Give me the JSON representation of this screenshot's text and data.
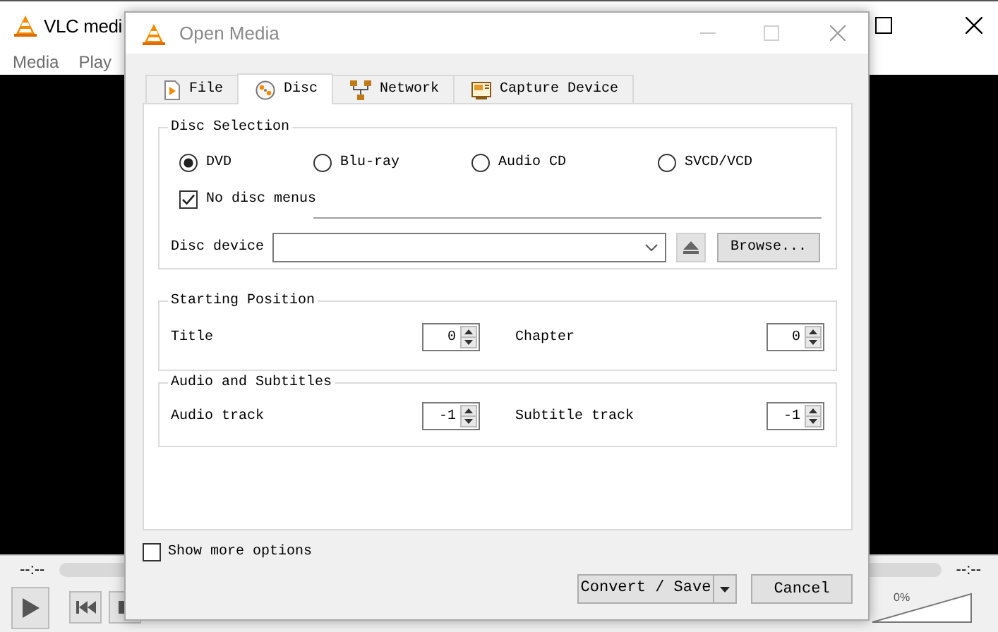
{
  "main_window": {
    "title": "VLC medi",
    "menu": [
      "Media",
      "Play"
    ],
    "elapsed": "--:--",
    "remaining": "--:--",
    "volume": "0%"
  },
  "dialog": {
    "title": "Open Media",
    "tabs": [
      {
        "label": "File",
        "kind": "file",
        "selected": false
      },
      {
        "label": "Disc",
        "kind": "disc",
        "selected": true
      },
      {
        "label": "Network",
        "kind": "network",
        "selected": false
      },
      {
        "label": "Capture Device",
        "kind": "capture",
        "selected": false
      }
    ],
    "disc_selection": {
      "title": "Disc Selection",
      "types": [
        {
          "label": "DVD",
          "selected": true
        },
        {
          "label": "Blu-ray",
          "selected": false
        },
        {
          "label": "Audio CD",
          "selected": false
        },
        {
          "label": "SVCD/VCD",
          "selected": false
        }
      ],
      "no_disc_menus": {
        "label": "No disc menus",
        "checked": true
      },
      "device_label": "Disc device",
      "browse": "Browse..."
    },
    "starting_position": {
      "title": "Starting Position",
      "fields": [
        {
          "label": "Title",
          "value": "0"
        },
        {
          "label": "Chapter",
          "value": "0"
        }
      ]
    },
    "audio_subtitles": {
      "title": "Audio and Subtitles",
      "fields": [
        {
          "label": "Audio track",
          "value": "-1"
        },
        {
          "label": "Subtitle track",
          "value": "-1"
        }
      ]
    },
    "show_more_options": {
      "label": "Show more options",
      "checked": false
    },
    "buttons": [
      {
        "label": "Convert / Save",
        "kind": "split"
      },
      {
        "label": "Cancel",
        "kind": "plain"
      }
    ]
  }
}
